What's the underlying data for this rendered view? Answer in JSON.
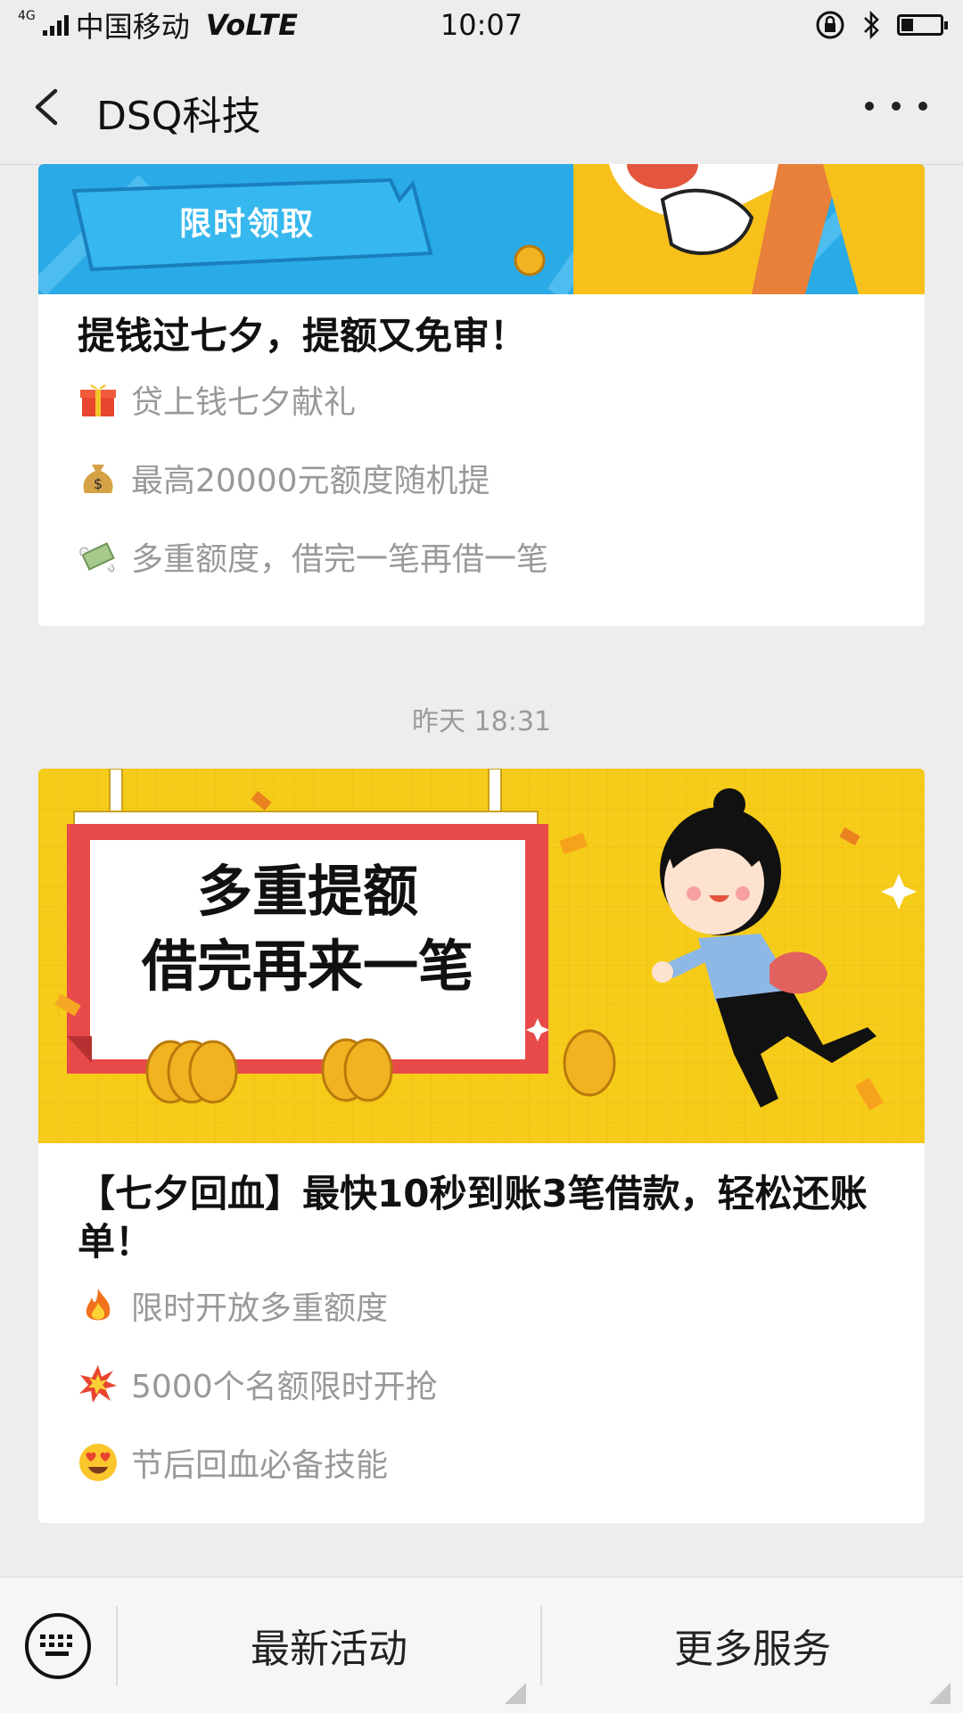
{
  "status": {
    "network": "4G",
    "carrier": "中国移动",
    "volte": "VoLTE",
    "time": "10:07",
    "battery_level": 0.3
  },
  "nav": {
    "title": "DSQ科技"
  },
  "card1": {
    "banner_text": "限时领取",
    "title": "提钱过七夕，提额又免审！",
    "items": [
      {
        "icon": "gift-icon",
        "text": "贷上钱七夕献礼"
      },
      {
        "icon": "money-bag-icon",
        "text": "最高20000元额度随机提"
      },
      {
        "icon": "flying-money-icon",
        "text": "多重额度，借完一笔再借一笔"
      }
    ]
  },
  "timestamp": "昨天 18:31",
  "card2": {
    "banner_line1": "多重提额",
    "banner_line2": "借完再来一笔",
    "title": "【七夕回血】最快10秒到账3笔借款，轻松还账单！",
    "items": [
      {
        "icon": "fire-icon",
        "text": "限时开放多重额度"
      },
      {
        "icon": "collision-icon",
        "text": "5000个名额限时开抢"
      },
      {
        "icon": "heart-eyes-icon",
        "text": "节后回血必备技能"
      }
    ]
  },
  "tabbar": {
    "tab1": "最新活动",
    "tab2": "更多服务"
  },
  "colors": {
    "banner_blue": "#29a9e6",
    "banner_yellow": "#f6cc1a",
    "frame_red": "#e84a4a",
    "muted_text": "#999999"
  }
}
